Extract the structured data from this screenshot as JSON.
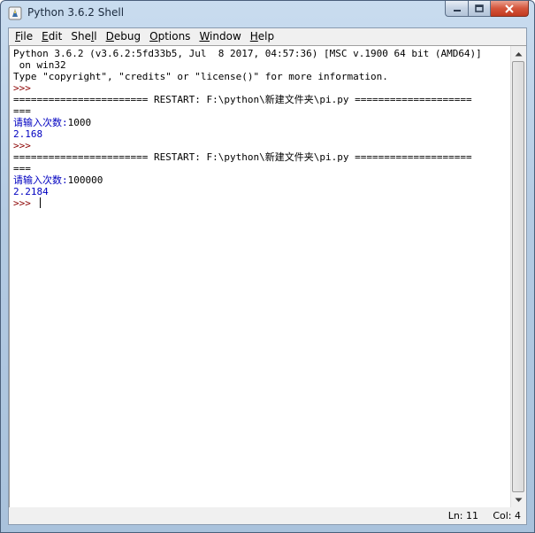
{
  "window": {
    "title": "Python 3.6.2 Shell"
  },
  "menu": {
    "items": [
      {
        "label": "File",
        "accel_index": 0
      },
      {
        "label": "Edit",
        "accel_index": 0
      },
      {
        "label": "Shell",
        "accel_index": 3
      },
      {
        "label": "Debug",
        "accel_index": 0
      },
      {
        "label": "Options",
        "accel_index": 0
      },
      {
        "label": "Window",
        "accel_index": 0
      },
      {
        "label": "Help",
        "accel_index": 0
      }
    ]
  },
  "shell": {
    "lines": [
      {
        "text": "Python 3.6.2 (v3.6.2:5fd33b5, Jul  8 2017, 04:57:36) [MSC v.1900 64 bit (AMD64)]",
        "kind": "out"
      },
      {
        "text": " on win32",
        "kind": "out"
      },
      {
        "text": "Type \"copyright\", \"credits\" or \"license()\" for more information.",
        "kind": "out"
      },
      {
        "text": ">>> ",
        "kind": "prompt"
      },
      {
        "text": "======================= RESTART: F:\\python\\新建文件夹\\pi.py ====================",
        "kind": "out"
      },
      {
        "text": "===",
        "kind": "out"
      },
      {
        "text": "请输入次数:",
        "kind": "blue",
        "input": "1000"
      },
      {
        "text": "2.168",
        "kind": "blue"
      },
      {
        "text": ">>> ",
        "kind": "prompt"
      },
      {
        "text": "======================= RESTART: F:\\python\\新建文件夹\\pi.py ====================",
        "kind": "out"
      },
      {
        "text": "===",
        "kind": "out"
      },
      {
        "text": "请输入次数:",
        "kind": "blue",
        "input": "100000"
      },
      {
        "text": "2.2184",
        "kind": "blue"
      },
      {
        "text": ">>> ",
        "kind": "prompt",
        "cursor": true
      }
    ]
  },
  "status": {
    "ln": "Ln: 11",
    "col": "Col: 4"
  },
  "colors": {
    "prompt": "#8b0000",
    "stdout": "#0000c0",
    "default": "#000000"
  }
}
